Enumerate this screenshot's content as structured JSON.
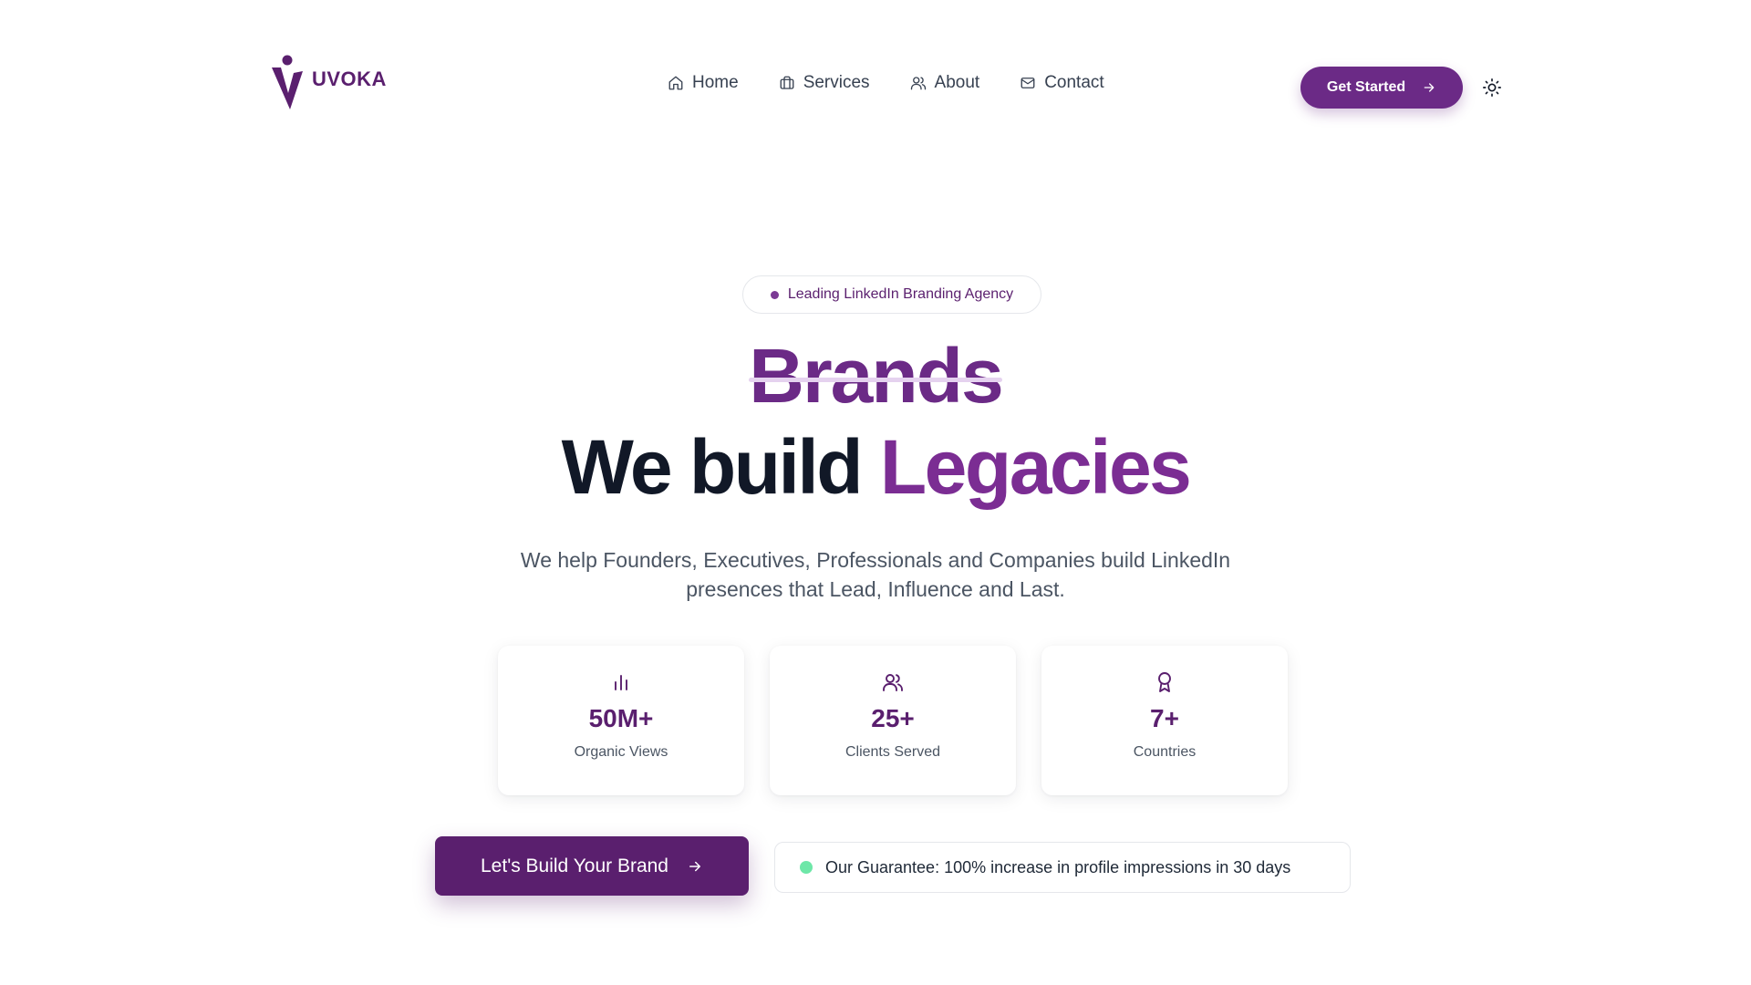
{
  "brand": {
    "name": "UVOKA",
    "logo_icon": "uvoka-v-person-logo",
    "color": "#5a1f6e"
  },
  "nav": {
    "items": [
      {
        "label": "Home",
        "icon": "home-icon"
      },
      {
        "label": "Services",
        "icon": "briefcase-icon"
      },
      {
        "label": "About",
        "icon": "users-icon"
      },
      {
        "label": "Contact",
        "icon": "mail-icon"
      }
    ],
    "cta_label": "Get Started",
    "theme_toggle_icon": "sun-icon"
  },
  "hero": {
    "badge": "Leading LinkedIn Branding Agency",
    "struck_word": "Brands",
    "title_prefix": "We build",
    "title_accent": "Legacies",
    "subtitle": "We help Founders, Executives, Professionals and Companies build LinkedIn presences that Lead, Influence and Last."
  },
  "stats": [
    {
      "icon": "bar-chart-icon",
      "value": "50M+",
      "label": "Organic Views"
    },
    {
      "icon": "users-icon",
      "value": "25+",
      "label": "Clients Served"
    },
    {
      "icon": "award-icon",
      "value": "7+",
      "label": "Countries"
    }
  ],
  "cta": {
    "primary_label": "Let's Build Your Brand",
    "guarantee": "Our Guarantee: 100% increase in profile impressions in 30 days"
  },
  "colors": {
    "accent": "#6b2a86",
    "accent_dark": "#5a1f6e",
    "guarantee_dot": "#6ee7a8"
  }
}
